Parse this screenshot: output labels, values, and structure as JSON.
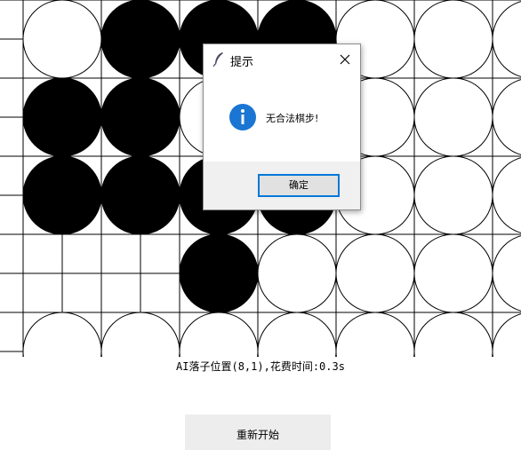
{
  "board": {
    "line_color": "#000000",
    "black_color": "#000000",
    "white_color": "#ffffff",
    "cols": 7,
    "rows": 5,
    "black_stones": [
      [
        1,
        0
      ],
      [
        2,
        0
      ],
      [
        3,
        0
      ],
      [
        0,
        1
      ],
      [
        1,
        1
      ],
      [
        3,
        1
      ],
      [
        0,
        2
      ],
      [
        1,
        2
      ],
      [
        2,
        2
      ],
      [
        3,
        2
      ],
      [
        2,
        3
      ]
    ],
    "white_stones": [
      [
        0,
        0
      ],
      [
        4,
        0
      ],
      [
        5,
        0
      ],
      [
        6,
        0
      ],
      [
        2,
        1
      ],
      [
        4,
        1
      ],
      [
        5,
        1
      ],
      [
        6,
        1
      ],
      [
        4,
        2
      ],
      [
        5,
        2
      ],
      [
        6,
        2
      ],
      [
        3,
        3
      ],
      [
        4,
        3
      ],
      [
        5,
        3
      ],
      [
        6,
        3
      ],
      [
        0,
        4
      ],
      [
        1,
        4
      ],
      [
        2,
        4
      ],
      [
        3,
        4
      ],
      [
        4,
        4
      ],
      [
        5,
        4
      ],
      [
        6,
        4
      ]
    ]
  },
  "status": {
    "text": "AI落子位置(8,1),花费时间:0.3s"
  },
  "restart_button": {
    "label": "重新开始"
  },
  "dialog": {
    "title": "提示",
    "message": "无合法棋步!",
    "ok_label": "确定",
    "icon": "info-icon",
    "icon_color": "#1a76d2",
    "ok_border_color": "#0078d7"
  }
}
